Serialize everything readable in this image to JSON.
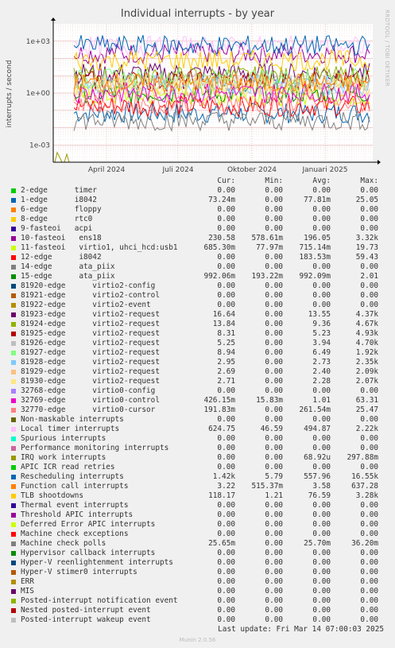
{
  "title": "Individual interrupts - by year",
  "side_label": "RRDTOOL / TOBI OETIKER",
  "footer": {
    "last_update": "Last update: Fri Mar 14 07:00:03 2025",
    "munin": "Munin 2.0.56"
  },
  "headers": {
    "cur": "Cur:",
    "min": "Min:",
    "avg": "Avg:",
    "max": "Max:"
  },
  "chart_data": {
    "type": "line",
    "title": "Individual interrupts - by year",
    "ylabel": "interrupts / second",
    "yscale": "log",
    "ylim": [
      0.0001,
      10000
    ],
    "yticks": [
      "1e-03",
      "1e+00",
      "1e+03"
    ],
    "xticks": [
      "April 2024",
      "Juli 2024",
      "Oktober 2024",
      "Januari 2025"
    ],
    "grid": true,
    "series": [
      {
        "name": "2-edge      timer",
        "color": "#00cc00",
        "cur": "0.00",
        "min": "0.00",
        "avg": "0.00",
        "max": "0.00",
        "level": 0
      },
      {
        "name": "1-edge      i8042",
        "color": "#0066b3",
        "cur": "73.24m",
        "min": "0.00",
        "avg": "77.81m",
        "max": "25.05",
        "level": 0.07
      },
      {
        "name": "6-edge      floppy",
        "color": "#ff8000",
        "cur": "0.00",
        "min": "0.00",
        "avg": "0.00",
        "max": "0.00",
        "level": 0
      },
      {
        "name": "8-edge      rtc0",
        "color": "#ffcc00",
        "cur": "0.00",
        "min": "0.00",
        "avg": "0.00",
        "max": "0.00",
        "level": 0
      },
      {
        "name": "9-fasteoi   acpi",
        "color": "#330099",
        "cur": "0.00",
        "min": "0.00",
        "avg": "0.00",
        "max": "0.00",
        "level": 0
      },
      {
        "name": "10-fasteoi   ens18",
        "color": "#990099",
        "cur": "230.58",
        "min": "578.61m",
        "avg": "196.05",
        "max": "3.32k",
        "level": 200
      },
      {
        "name": "11-fasteoi   virtio1, uhci_hcd:usb1",
        "color": "#ccff00",
        "cur": "685.30m",
        "min": "77.97m",
        "avg": "715.14m",
        "max": "19.73",
        "level": 0.7
      },
      {
        "name": "12-edge      i8042",
        "color": "#ff0000",
        "cur": "0.00",
        "min": "0.00",
        "avg": "183.53m",
        "max": "59.43",
        "level": 0.18
      },
      {
        "name": "14-edge      ata_piix",
        "color": "#808080",
        "cur": "0.00",
        "min": "0.00",
        "avg": "0.00",
        "max": "0.00",
        "level": 0
      },
      {
        "name": "15-edge      ata_piix",
        "color": "#008f00",
        "cur": "992.06m",
        "min": "193.22m",
        "avg": "992.09m",
        "max": "2.01",
        "level": 1
      },
      {
        "name": "81920-edge      virtio2-config",
        "color": "#00487d",
        "cur": "0.00",
        "min": "0.00",
        "avg": "0.00",
        "max": "0.00",
        "level": 0
      },
      {
        "name": "81921-edge      virtio2-control",
        "color": "#b35a00",
        "cur": "0.00",
        "min": "0.00",
        "avg": "0.00",
        "max": "0.00",
        "level": 0
      },
      {
        "name": "81922-edge      virtio2-event",
        "color": "#b38f00",
        "cur": "0.00",
        "min": "0.00",
        "avg": "0.00",
        "max": "0.00",
        "level": 0
      },
      {
        "name": "81923-edge      virtio2-request",
        "color": "#6b006b",
        "cur": "16.64",
        "min": "0.00",
        "avg": "13.55",
        "max": "4.37k",
        "level": 14
      },
      {
        "name": "81924-edge      virtio2-request",
        "color": "#8fb300",
        "cur": "13.84",
        "min": "0.00",
        "avg": "9.36",
        "max": "4.67k",
        "level": 9
      },
      {
        "name": "81925-edge      virtio2-request",
        "color": "#b30000",
        "cur": "8.31",
        "min": "0.00",
        "avg": "5.23",
        "max": "4.93k",
        "level": 5
      },
      {
        "name": "81926-edge      virtio2-request",
        "color": "#bebebe",
        "cur": "5.25",
        "min": "0.00",
        "avg": "3.94",
        "max": "4.70k",
        "level": 4
      },
      {
        "name": "81927-edge      virtio2-request",
        "color": "#80ff80",
        "cur": "8.94",
        "min": "0.00",
        "avg": "6.49",
        "max": "1.92k",
        "level": 6.5
      },
      {
        "name": "81928-edge      virtio2-request",
        "color": "#80c9ff",
        "cur": "2.95",
        "min": "0.00",
        "avg": "2.73",
        "max": "2.35k",
        "level": 2.7
      },
      {
        "name": "81929-edge      virtio2-request",
        "color": "#ffc080",
        "cur": "2.69",
        "min": "0.00",
        "avg": "2.40",
        "max": "2.09k",
        "level": 2.4
      },
      {
        "name": "81930-edge      virtio2-request",
        "color": "#ffe680",
        "cur": "2.71",
        "min": "0.00",
        "avg": "2.28",
        "max": "2.07k",
        "level": 2.3
      },
      {
        "name": "32768-edge      virtio0-config",
        "color": "#aa80ff",
        "cur": "0.00",
        "min": "0.00",
        "avg": "0.00",
        "max": "0.00",
        "level": 0
      },
      {
        "name": "32769-edge      virtio0-control",
        "color": "#ee00cc",
        "cur": "426.15m",
        "min": "15.83m",
        "avg": "1.01",
        "max": "63.31",
        "level": 1
      },
      {
        "name": "32770-edge      virtio0-cursor",
        "color": "#ff8080",
        "cur": "191.83m",
        "min": "0.00",
        "avg": "261.54m",
        "max": "25.47",
        "level": 0.26
      },
      {
        "name": "Non-maskable interrupts",
        "color": "#666600",
        "cur": "0.00",
        "min": "0.00",
        "avg": "0.00",
        "max": "0.00",
        "level": 0
      },
      {
        "name": "Local timer interrupts",
        "color": "#ffbfff",
        "cur": "624.75",
        "min": "46.59",
        "avg": "494.87",
        "max": "2.22k",
        "level": 495
      },
      {
        "name": "Spurious interrupts",
        "color": "#00ffcc",
        "cur": "0.00",
        "min": "0.00",
        "avg": "0.00",
        "max": "0.00",
        "level": 0
      },
      {
        "name": "Performance monitoring interrupts",
        "color": "#cc6699",
        "cur": "0.00",
        "min": "0.00",
        "avg": "0.00",
        "max": "0.00",
        "level": 0
      },
      {
        "name": "IRQ work interrupts",
        "color": "#999900",
        "cur": "0.00",
        "min": "0.00",
        "avg": "68.92u",
        "max": "297.88m",
        "level": 0.0001
      },
      {
        "name": "APIC ICR read retries",
        "color": "#00cc00",
        "cur": "0.00",
        "min": "0.00",
        "avg": "0.00",
        "max": "0.00",
        "level": 0
      },
      {
        "name": "Rescheduling interrupts",
        "color": "#0066b3",
        "cur": "1.42k",
        "min": "5.79",
        "avg": "557.96",
        "max": "16.55k",
        "level": 558
      },
      {
        "name": "Function call interrupts",
        "color": "#ff8000",
        "cur": "3.22",
        "min": "515.37m",
        "avg": "3.58",
        "max": "637.28",
        "level": 3.6
      },
      {
        "name": "TLB shootdowns",
        "color": "#ffcc00",
        "cur": "118.17",
        "min": "1.21",
        "avg": "76.59",
        "max": "3.28k",
        "level": 77
      },
      {
        "name": "Thermal event interrupts",
        "color": "#330099",
        "cur": "0.00",
        "min": "0.00",
        "avg": "0.00",
        "max": "0.00",
        "level": 0
      },
      {
        "name": "Threshold APIC interrupts",
        "color": "#990099",
        "cur": "0.00",
        "min": "0.00",
        "avg": "0.00",
        "max": "0.00",
        "level": 0
      },
      {
        "name": "Deferred Error APIC interrupts",
        "color": "#ccff00",
        "cur": "0.00",
        "min": "0.00",
        "avg": "0.00",
        "max": "0.00",
        "level": 0
      },
      {
        "name": "Machine check exceptions",
        "color": "#ff0000",
        "cur": "0.00",
        "min": "0.00",
        "avg": "0.00",
        "max": "0.00",
        "level": 0
      },
      {
        "name": "Machine check polls",
        "color": "#808080",
        "cur": "25.65m",
        "min": "0.00",
        "avg": "25.70m",
        "max": "36.20m",
        "level": 0.0257
      },
      {
        "name": "Hypervisor callback interrupts",
        "color": "#008f00",
        "cur": "0.00",
        "min": "0.00",
        "avg": "0.00",
        "max": "0.00",
        "level": 0
      },
      {
        "name": "Hyper-V reenlightenment interrupts",
        "color": "#00487d",
        "cur": "0.00",
        "min": "0.00",
        "avg": "0.00",
        "max": "0.00",
        "level": 0
      },
      {
        "name": "Hyper-V stimer0 interrupts",
        "color": "#b35a00",
        "cur": "0.00",
        "min": "0.00",
        "avg": "0.00",
        "max": "0.00",
        "level": 0
      },
      {
        "name": "ERR",
        "color": "#b38f00",
        "cur": "0.00",
        "min": "0.00",
        "avg": "0.00",
        "max": "0.00",
        "level": 0
      },
      {
        "name": "MIS",
        "color": "#6b006b",
        "cur": "0.00",
        "min": "0.00",
        "avg": "0.00",
        "max": "0.00",
        "level": 0
      },
      {
        "name": "Posted-interrupt notification event",
        "color": "#8fb300",
        "cur": "0.00",
        "min": "0.00",
        "avg": "0.00",
        "max": "0.00",
        "level": 0
      },
      {
        "name": "Nested posted-interrupt event",
        "color": "#b30000",
        "cur": "0.00",
        "min": "0.00",
        "avg": "0.00",
        "max": "0.00",
        "level": 0
      },
      {
        "name": "Posted-interrupt wakeup event",
        "color": "#bebebe",
        "cur": "0.00",
        "min": "0.00",
        "avg": "0.00",
        "max": "0.00",
        "level": 0
      }
    ]
  }
}
